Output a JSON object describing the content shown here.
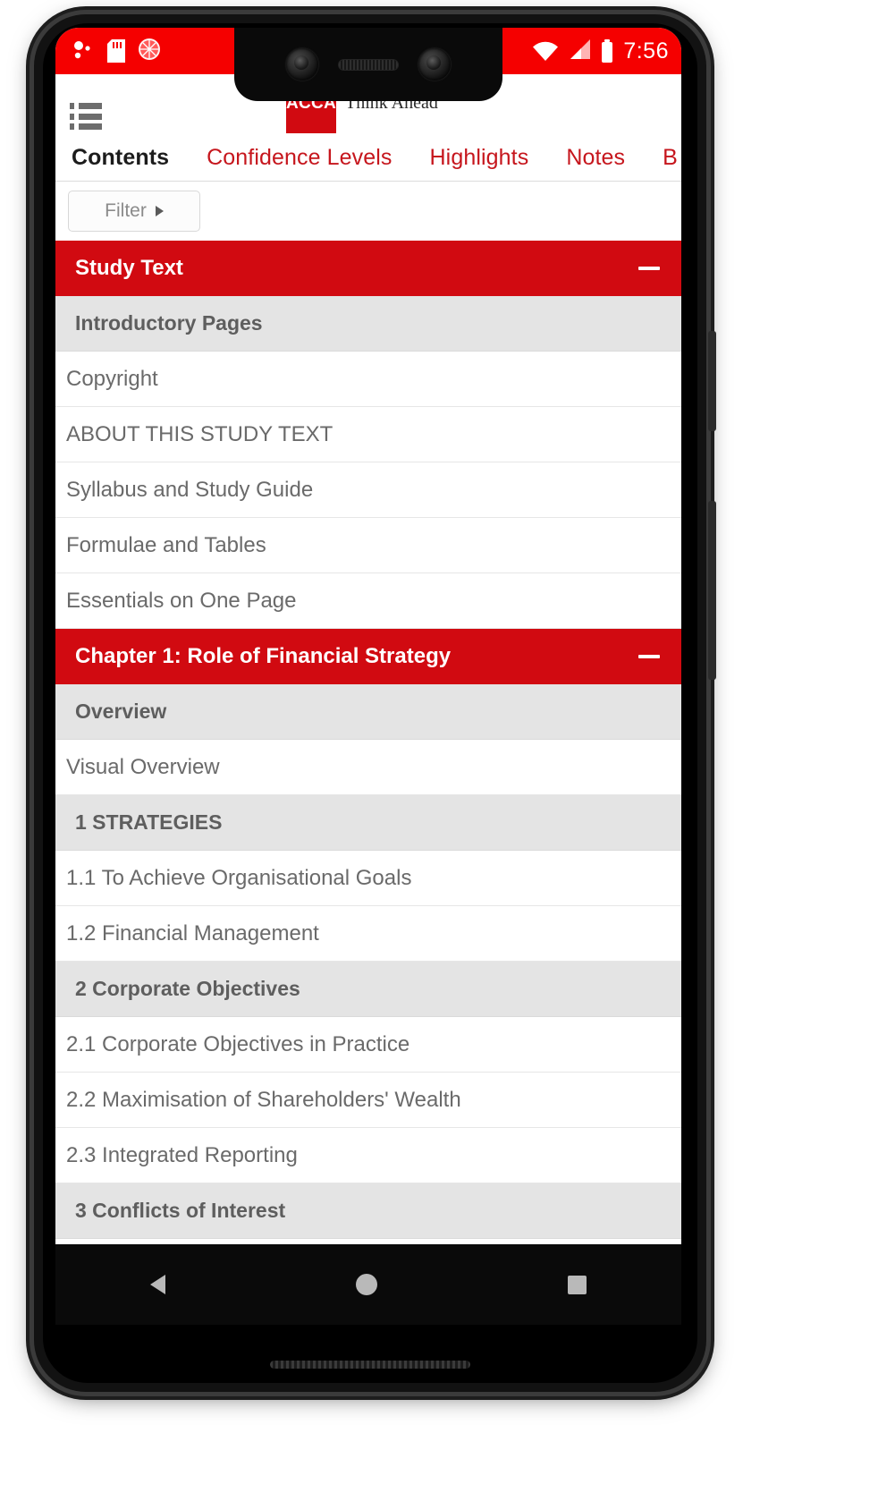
{
  "status_bar": {
    "time": "7:56",
    "left_icons": [
      "notification-dots-icon",
      "sd-card-icon",
      "screen-record-icon"
    ],
    "right_icons": [
      "wifi-icon",
      "cellular-signal-icon",
      "battery-icon"
    ],
    "background_color": "#f50000"
  },
  "header": {
    "menu_icon": "hamburger-list-icon",
    "brand_mark": "ACCA",
    "brand_tagline": "Think Ahead",
    "brand_color": "#d10a11"
  },
  "tabs": [
    {
      "label": "Contents",
      "active": true
    },
    {
      "label": "Confidence Levels",
      "active": false
    },
    {
      "label": "Highlights",
      "active": false
    },
    {
      "label": "Notes",
      "active": false
    },
    {
      "label": "B",
      "active": false
    }
  ],
  "filter": {
    "label": "Filter",
    "caret_icon": "caret-right-icon"
  },
  "contents": [
    {
      "type": "section-header",
      "label": "Study Text",
      "collapse_icon": "minus-icon"
    },
    {
      "type": "group",
      "label": "Introductory Pages"
    },
    {
      "type": "leaf",
      "label": "Copyright"
    },
    {
      "type": "leaf",
      "label": "ABOUT THIS STUDY TEXT"
    },
    {
      "type": "leaf",
      "label": "Syllabus and Study Guide"
    },
    {
      "type": "leaf",
      "label": "Formulae and Tables"
    },
    {
      "type": "leaf",
      "label": "Essentials on One Page"
    },
    {
      "type": "section-header",
      "label": "Chapter 1: Role of Financial Strategy",
      "collapse_icon": "minus-icon"
    },
    {
      "type": "group",
      "label": "Overview"
    },
    {
      "type": "leaf",
      "label": "Visual Overview"
    },
    {
      "type": "group",
      "label": "1 STRATEGIES"
    },
    {
      "type": "leaf",
      "label": "1.1 To Achieve Organisational Goals"
    },
    {
      "type": "leaf",
      "label": "1.2 Financial Management"
    },
    {
      "type": "group",
      "label": "2 Corporate Objectives"
    },
    {
      "type": "leaf",
      "label": "2.1 Corporate Objectives in Practice"
    },
    {
      "type": "leaf",
      "label": "2.2 Maximisation of Shareholders' Wealth"
    },
    {
      "type": "leaf",
      "label": "2.3 Integrated Reporting"
    },
    {
      "type": "group",
      "label": "3 Conflicts of Interest"
    }
  ],
  "nav_bar": {
    "back_icon": "triangle-back-icon",
    "home_icon": "circle-home-icon",
    "recents_icon": "square-recents-icon"
  }
}
